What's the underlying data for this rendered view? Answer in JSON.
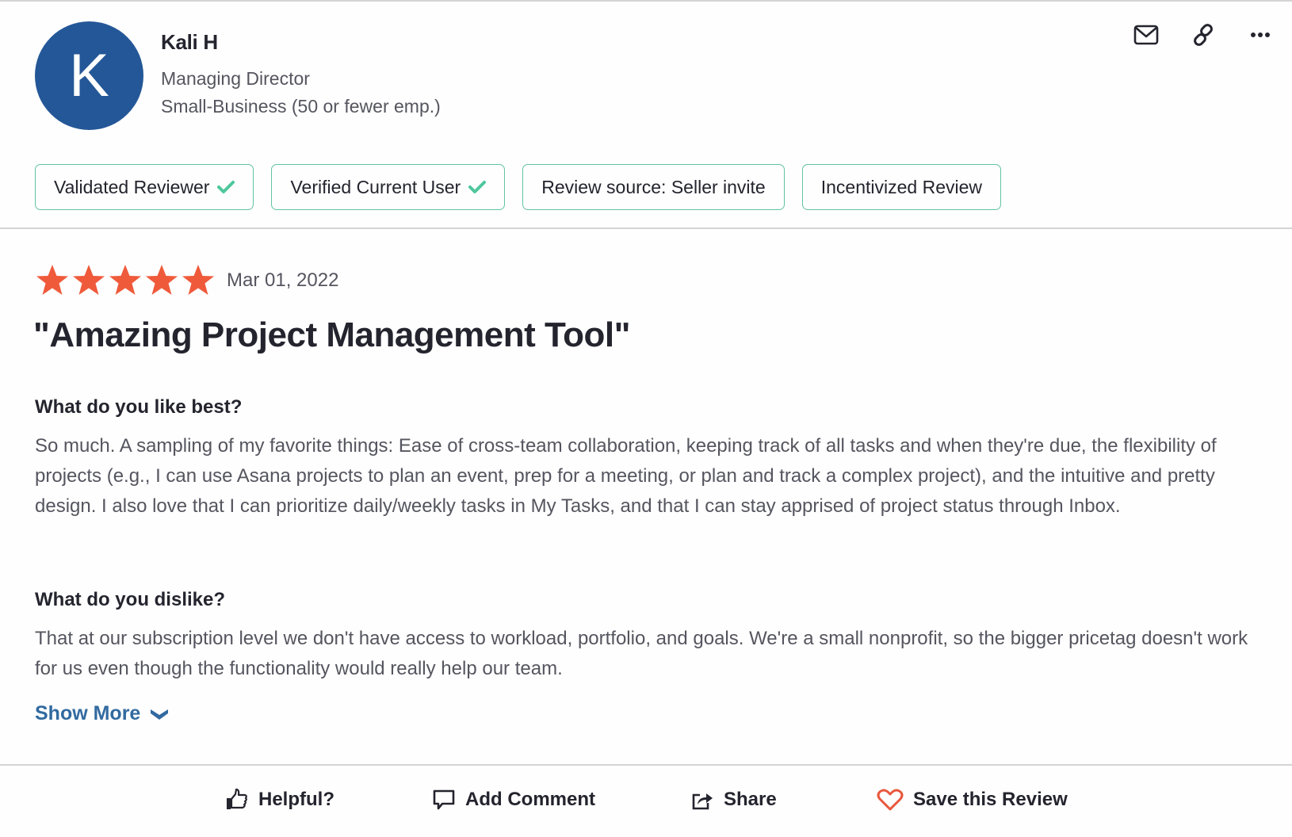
{
  "reviewer": {
    "avatar_initial": "K",
    "avatar_color": "#245797",
    "name": "Kali H",
    "title": "Managing Director",
    "company_size": "Small-Business (50 or fewer emp.)"
  },
  "header_actions": [
    {
      "icon": "mail-icon",
      "label": "Email"
    },
    {
      "icon": "link-icon",
      "label": "Copy link"
    },
    {
      "icon": "more-icon",
      "label": "More options"
    }
  ],
  "badges": [
    {
      "label": "Validated Reviewer",
      "checked": true
    },
    {
      "label": "Verified Current User",
      "checked": true
    },
    {
      "label": "Review source: Seller invite",
      "checked": false
    },
    {
      "label": "Incentivized Review",
      "checked": false
    }
  ],
  "review": {
    "rating": 5,
    "rating_max": 5,
    "date": "Mar 01, 2022",
    "title": "\"Amazing Project Management Tool\"",
    "likes_heading": "What do you like best?",
    "likes_text": "So much. A sampling of my favorite things: Ease of cross-team collaboration, keeping track of all tasks and when they're due, the flexibility of projects (e.g., I can use Asana projects to plan an event, prep for a meeting, or plan and track a complex project), and the intuitive and pretty design. I also love that I can prioritize daily/weekly tasks in My Tasks, and that I can stay apprised of project status through Inbox.",
    "dislikes_heading": "What do you dislike?",
    "dislikes_text": "That at our subscription level we don't have access to workload, portfolio, and goals. We're a small nonprofit, so the bigger pricetag doesn't work for us even though the functionality would really help our team.",
    "show_more_label": "Show More"
  },
  "footer_actions": {
    "helpful": "Helpful?",
    "add_comment": "Add Comment",
    "share": "Share",
    "save": "Save this Review"
  },
  "colors": {
    "star": "#ef5a3b",
    "badge_border": "#62c3a4",
    "check": "#4fc79c",
    "link": "#326aa0",
    "heart": "#e8573d"
  }
}
